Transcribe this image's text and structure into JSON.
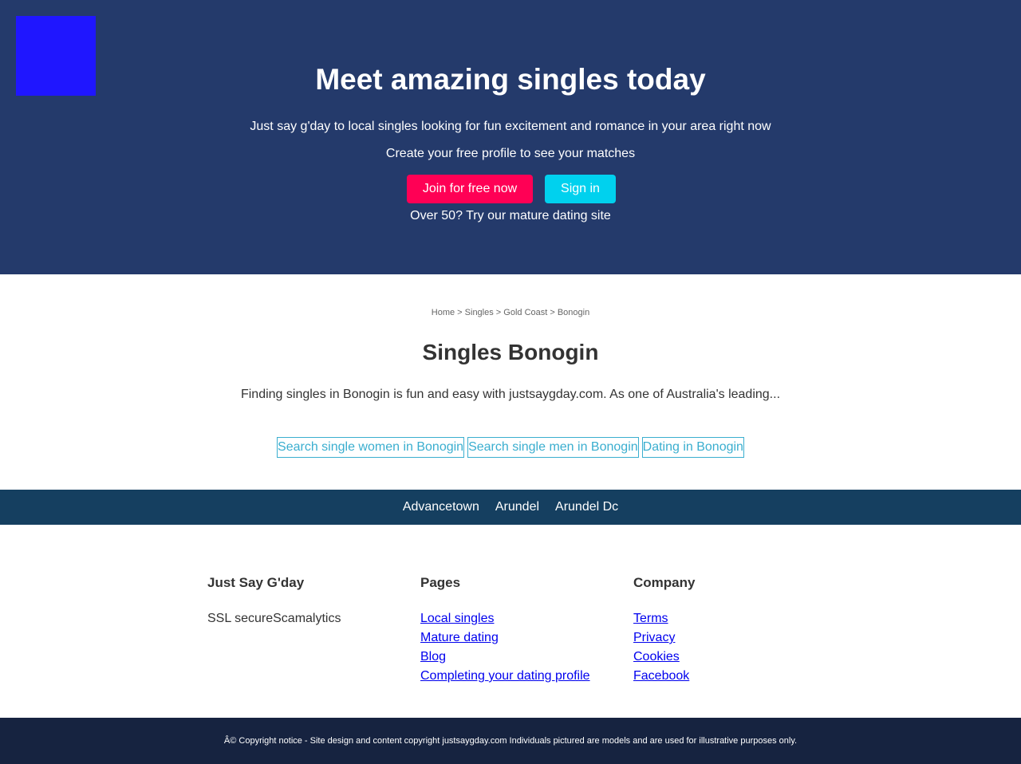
{
  "hero": {
    "title": "Meet amazing singles today",
    "subtitle": "Just say g'day to local singles looking for fun excitement and romance in your area right now",
    "cta_text": "Create your free profile to see your matches",
    "join_label": "Join for free now",
    "signin_label": "Sign in",
    "mature_text": "Over 50? Try our mature dating site",
    "bg_color": "#243a6b",
    "join_color": "#ff0055",
    "signin_color": "#00d1ee",
    "logo_color": "#1f16ff"
  },
  "breadcrumb": "Home > Singles > Gold Coast > Bonogin",
  "main": {
    "title": "Singles Bonogin",
    "intro": "Finding singles in Bonogin is fun and easy with justsaygday.com. As one of Australia's leading...",
    "search_links": [
      "Search single women in Bonogin",
      "Search single men in Bonogin",
      "Dating in Bonogin"
    ]
  },
  "nearby": [
    "Advancetown",
    "Arundel",
    "Arundel Dc"
  ],
  "footer": {
    "col1": {
      "heading": "Just Say G'day",
      "text": "SSL secureScamalytics"
    },
    "col2": {
      "heading": "Pages",
      "links": [
        "Local singles",
        "Mature dating",
        "Blog",
        "Completing your dating profile"
      ]
    },
    "col3": {
      "heading": "Company",
      "links": [
        "Terms",
        "Privacy",
        "Cookies",
        "Facebook"
      ]
    }
  },
  "copyright": "Â© Copyright notice - Site design and content copyright justsaygday.com Individuals pictured are models and are used for illustrative purposes only."
}
